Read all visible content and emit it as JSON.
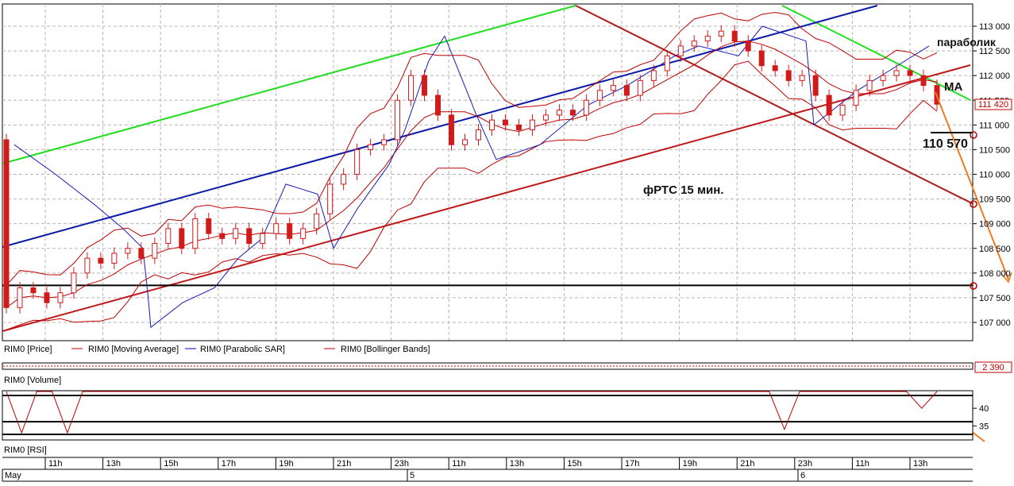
{
  "chart_data": {
    "type": "candlestick",
    "instrument": "RIM0",
    "annotations": {
      "title": "фРТС   15 мин.",
      "sar": "параболик",
      "ma": "MA",
      "target": "110 570"
    },
    "price_axis": {
      "ticks": [
        113000,
        112500,
        112000,
        111500,
        111000,
        110500,
        110000,
        109500,
        109000,
        108500,
        108000,
        107500,
        107000
      ],
      "tick_labels": [
        "113 000",
        "112 500",
        "112 000",
        "111 500",
        "111 000",
        "110 500",
        "110 000",
        "109 500",
        "109 000",
        "108 500",
        "108 000",
        "107 500",
        "107 000"
      ],
      "current_price": "111 420",
      "range": [
        106600,
        113250
      ]
    },
    "legend": [
      {
        "label": "RIM0 [Price]",
        "color": "#000000"
      },
      {
        "label": "RIM0 [Moving Average]",
        "color": "#c00000"
      },
      {
        "label": "RIM0 [Parabolic SAR]",
        "color": "#0000cc"
      },
      {
        "label": "RIM0 [Bollinger Bands]",
        "color": "#c00000"
      }
    ],
    "volume_panel": {
      "label": "RIM0 [Volume]",
      "value": "2 390"
    },
    "rsi_panel": {
      "label": "RIM0 [RSI]",
      "ticks": [
        40,
        35
      ],
      "tick_labels": [
        "40",
        "35"
      ],
      "range": [
        31,
        45
      ],
      "values": [
        45,
        33,
        45,
        45,
        33,
        45,
        45,
        45,
        45,
        45,
        45,
        45,
        45,
        45,
        45,
        45,
        45,
        45,
        45,
        45,
        45,
        45,
        45,
        45,
        45,
        45,
        45,
        45,
        45,
        45,
        45,
        45,
        45,
        45,
        45,
        45,
        45,
        45,
        45,
        45,
        45,
        45,
        45,
        45,
        45,
        45,
        45,
        45,
        45,
        45,
        45,
        34,
        45,
        45,
        45,
        45,
        45,
        45,
        45,
        45,
        40,
        45
      ]
    },
    "time_axis": {
      "hours": [
        "11h",
        "13h",
        "15h",
        "17h",
        "19h",
        "21h",
        "23h",
        "11h",
        "13h",
        "15h",
        "17h",
        "19h",
        "21h",
        "23h",
        "11h",
        "13h"
      ],
      "dates": [
        "May",
        "5",
        "6"
      ]
    },
    "support_line": 107750,
    "close": [
      107300,
      107700,
      107600,
      107400,
      107600,
      108000,
      108300,
      108200,
      108400,
      108500,
      108300,
      108600,
      108900,
      108500,
      109100,
      108800,
      108700,
      108900,
      108600,
      108800,
      109000,
      108700,
      108900,
      109200,
      109800,
      110000,
      110500,
      110600,
      110700,
      111500,
      112000,
      111600,
      111200,
      110600,
      110700,
      110900,
      111100,
      111000,
      110900,
      111100,
      111200,
      111300,
      111200,
      111500,
      111700,
      111800,
      111600,
      111900,
      112100,
      112400,
      112600,
      112700,
      112800,
      112900,
      112700,
      112500,
      112200,
      112100,
      111900,
      112000,
      111600,
      111200,
      111400,
      111700,
      111900,
      112000,
      112100,
      112000,
      111800,
      111420
    ],
    "sar": [
      110600,
      110000,
      109400,
      108900,
      108500,
      107600,
      106900,
      107400,
      107700,
      108300,
      108700,
      109800,
      109600,
      108500,
      109300,
      110200,
      110900,
      112300,
      112800,
      111200,
      110300,
      110600,
      111400,
      111800,
      112000,
      112400,
      112600,
      112400,
      113000,
      112700,
      111000,
      111700,
      112100,
      112600
    ],
    "sar_x": [
      18,
      70,
      118,
      155,
      180,
      186,
      190,
      230,
      270,
      300,
      330,
      360,
      400,
      420,
      450,
      490,
      510,
      540,
      560,
      600,
      625,
      680,
      740,
      790,
      810,
      850,
      880,
      930,
      960,
      1015,
      1025,
      1080,
      1120,
      1170
    ]
  }
}
